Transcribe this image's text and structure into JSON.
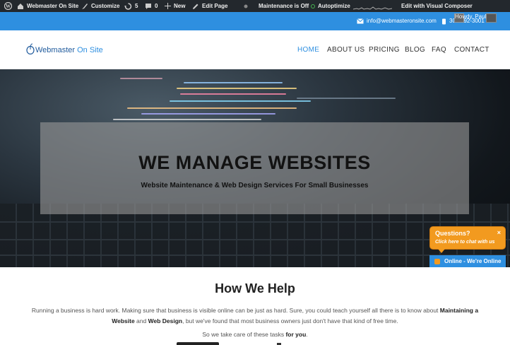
{
  "admin_bar": {
    "site_name": "Webmaster On Site",
    "customize": "Customize",
    "updates": "5",
    "comments": "0",
    "new": "New",
    "edit_page": "Edit Page",
    "maintenance": "Maintenance is Off",
    "autoptimize": "Autoptimize",
    "visual_composer": "Edit with Visual Composer",
    "user": "Howdy, Paul"
  },
  "contact": {
    "email": "info@webmasteronsite.com",
    "phone": "301-892-3001"
  },
  "logo": {
    "text_part1": "Webmaster",
    "text_part2": " On Site"
  },
  "nav": [
    "HOME",
    "ABOUT US",
    "PRICING",
    "BLOG",
    "FAQ",
    "CONTACT"
  ],
  "hero": {
    "title": "WE MANAGE WEBSITES",
    "subtitle": "Website Maintenance & Web Design Services For Small Businesses"
  },
  "chat": {
    "question": "Questions?",
    "hint": "Click here to chat with us",
    "close": "×",
    "online": "Online - We're Online"
  },
  "help": {
    "heading": "How We Help",
    "paragraph_intro": "Running a business is hard work. Making sure that business is visible online can be just as hard. Sure, you could teach yourself all there is to know about ",
    "maintaining": "Maintaining a Website",
    "and": " and ",
    "web_design": "Web Design",
    "paragraph_end": ", but we've found that most business owners just don't have that kind of free time.",
    "care_text": "So we take care of these tasks ",
    "for_you": "for you",
    "period": "."
  },
  "colors": {
    "brand_blue": "#2e8fe0",
    "admin_bar": "#23282d",
    "chat_orange": "#f29a1f"
  }
}
